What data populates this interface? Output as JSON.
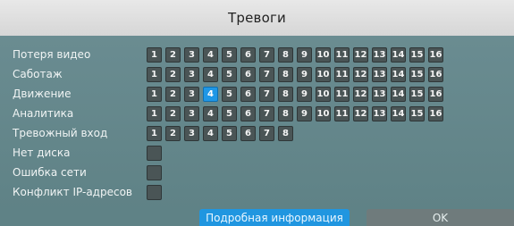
{
  "dialog": {
    "title": "Тревоги"
  },
  "rows": [
    {
      "label": "Потеря видео",
      "cells": [
        "1",
        "2",
        "3",
        "4",
        "5",
        "6",
        "7",
        "8",
        "9",
        "10",
        "11",
        "12",
        "13",
        "14",
        "15",
        "16"
      ],
      "selected": []
    },
    {
      "label": "Саботаж",
      "cells": [
        "1",
        "2",
        "3",
        "4",
        "5",
        "6",
        "7",
        "8",
        "9",
        "10",
        "11",
        "12",
        "13",
        "14",
        "15",
        "16"
      ],
      "selected": []
    },
    {
      "label": "Движение",
      "cells": [
        "1",
        "2",
        "3",
        "4",
        "5",
        "6",
        "7",
        "8",
        "9",
        "10",
        "11",
        "12",
        "13",
        "14",
        "15",
        "16"
      ],
      "selected": [
        "4"
      ]
    },
    {
      "label": "Аналитика",
      "cells": [
        "1",
        "2",
        "3",
        "4",
        "5",
        "6",
        "7",
        "8",
        "9",
        "10",
        "11",
        "12",
        "13",
        "14",
        "15",
        "16"
      ],
      "selected": []
    },
    {
      "label": "Тревожный вход",
      "cells": [
        "1",
        "2",
        "3",
        "4",
        "5",
        "6",
        "7",
        "8"
      ],
      "selected": []
    },
    {
      "label": "Нет диска",
      "cells": [
        ""
      ],
      "selected": []
    },
    {
      "label": "Ошибка сети",
      "cells": [
        ""
      ],
      "selected": []
    },
    {
      "label": "Конфликт IP-адресов",
      "cells": [
        ""
      ],
      "selected": []
    }
  ],
  "buttons": {
    "details": "Подробная информация",
    "ok": "OK"
  }
}
